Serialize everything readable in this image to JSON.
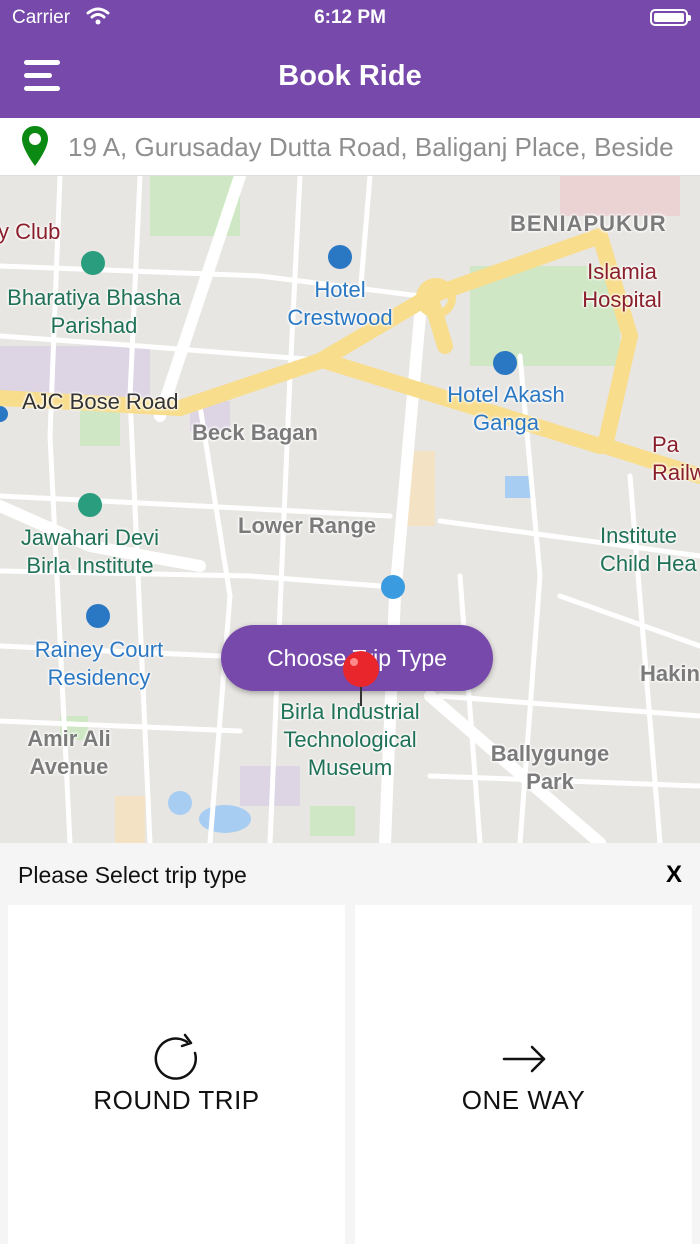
{
  "status_bar": {
    "carrier": "Carrier",
    "time": "6:12 PM",
    "icons": [
      "wifi-icon",
      "battery-icon"
    ]
  },
  "nav": {
    "title": "Book Ride",
    "menu_icon": "hamburger-menu-icon"
  },
  "address": {
    "value": "19 A, Gurusaday Dutta Road, Baliganj Place, Beside",
    "icon": "location-pin-icon",
    "icon_color": "#0a8a12"
  },
  "map": {
    "labels": {
      "club": "y Club",
      "beniapukur": "BENIAPUKUR",
      "islamia": "Islamia Hospital",
      "hotel_crestwood": "Hotel Crestwood",
      "bharatiya": "Bharatiya Bhasha Parishad",
      "ajc": "AJC Bose Road",
      "hotel_akash": "Hotel Akash Ganga",
      "beck_bagan": "Beck Bagan",
      "pa_railw": "Pa Railw",
      "jawahari": "Jawahari Devi Birla Institute",
      "lower_range": "Lower Range",
      "institute_child": "Institute Child Hea",
      "rainey": "Rainey Court Residency",
      "hakin": "Hakin",
      "amir_ali": "Amir Ali Avenue",
      "birla_museum": "Birla Industrial Technological Museum",
      "ballygunge": "Ballygunge Park"
    },
    "choose_button": "Choose Trip Type",
    "pin_color": "#e8262b"
  },
  "sheet": {
    "prompt": "Please Select trip type",
    "close": "X",
    "options": [
      {
        "label": "ROUND TRIP",
        "icon": "refresh-icon"
      },
      {
        "label": "ONE WAY",
        "icon": "arrow-right-icon"
      }
    ]
  },
  "colors": {
    "primary": "#7649ab",
    "sheet_bg": "#f4f5f4"
  }
}
